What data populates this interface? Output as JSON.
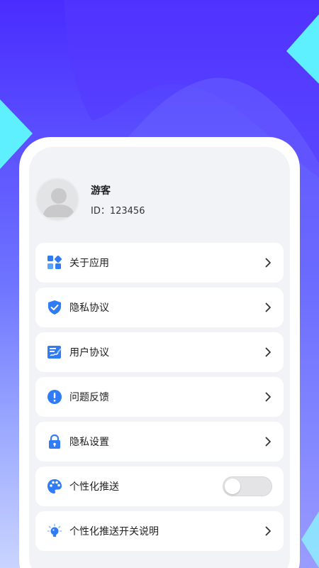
{
  "profile": {
    "name": "游客",
    "id_text": "ID：123456"
  },
  "menu": {
    "items": [
      {
        "label": "关于应用",
        "icon": "app-grid-icon"
      },
      {
        "label": "隐私协议",
        "icon": "shield-check-icon"
      },
      {
        "label": "用户协议",
        "icon": "document-sign-icon"
      },
      {
        "label": "问题反馈",
        "icon": "exclamation-icon"
      },
      {
        "label": "隐私设置",
        "icon": "lock-icon"
      },
      {
        "label": "个性化推送",
        "icon": "palette-icon",
        "toggle": false
      },
      {
        "label": "个性化推送开关说明",
        "icon": "lightbulb-icon"
      }
    ]
  },
  "colors": {
    "background_top": "#4a2cff",
    "background_bottom": "#c9d4ff",
    "accent_cyan": "#5ff0ff",
    "icon_blue": "#2f7cf6"
  }
}
